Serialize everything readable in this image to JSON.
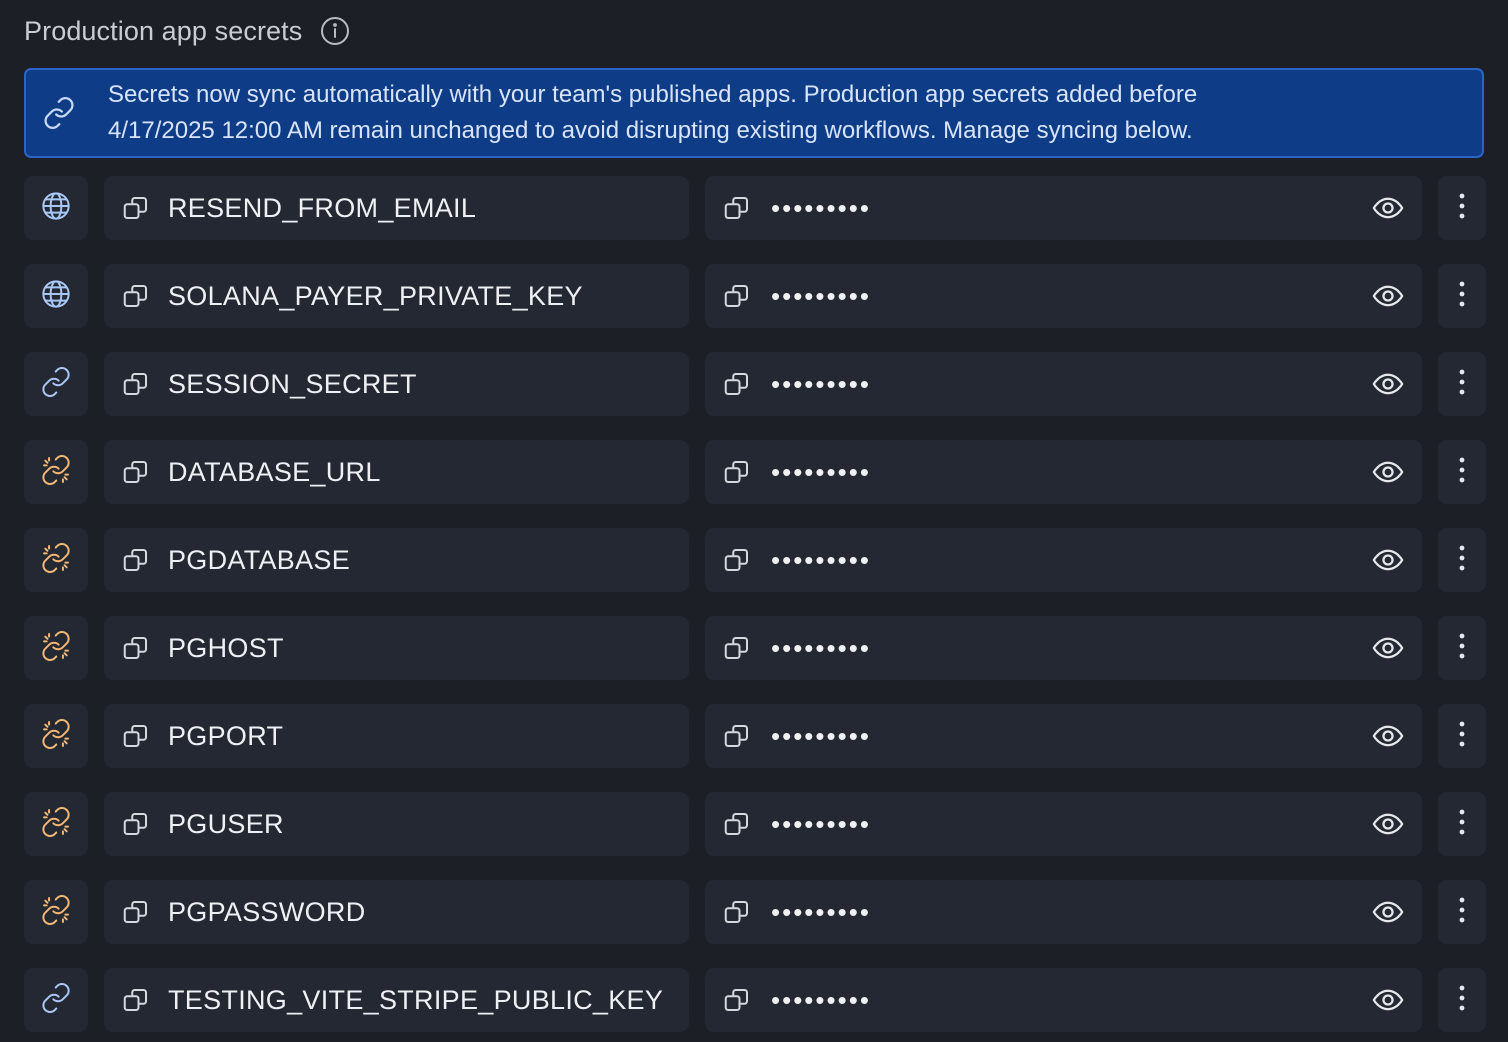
{
  "header": {
    "title": "Production app secrets",
    "info_icon": "info-icon"
  },
  "banner": {
    "icon": "link-icon",
    "line1": "Secrets now sync automatically with your team's published apps. Production app secrets added before",
    "line2": "4/17/2025 12:00 AM remain unchanged to avoid disrupting existing workflows. Manage syncing below."
  },
  "colors": {
    "background": "#1c1f26",
    "cell": "#242832",
    "banner_bg": "#0f3c87",
    "banner_border": "#2c63c7",
    "synced_icon": "#a9c7f5",
    "unsynced_icon": "#f2b672"
  },
  "secrets": [
    {
      "key": "RESEND_FROM_EMAIL",
      "value_masked": "•••••••••",
      "sync_icon": "globe-icon"
    },
    {
      "key": "SOLANA_PAYER_PRIVATE_KEY",
      "value_masked": "•••••••••",
      "sync_icon": "globe-icon"
    },
    {
      "key": "SESSION_SECRET",
      "value_masked": "•••••••••",
      "sync_icon": "link-icon"
    },
    {
      "key": "DATABASE_URL",
      "value_masked": "•••••••••",
      "sync_icon": "unlink-icon"
    },
    {
      "key": "PGDATABASE",
      "value_masked": "•••••••••",
      "sync_icon": "unlink-icon"
    },
    {
      "key": "PGHOST",
      "value_masked": "•••••••••",
      "sync_icon": "unlink-icon"
    },
    {
      "key": "PGPORT",
      "value_masked": "•••••••••",
      "sync_icon": "unlink-icon"
    },
    {
      "key": "PGUSER",
      "value_masked": "•••••••••",
      "sync_icon": "unlink-icon"
    },
    {
      "key": "PGPASSWORD",
      "value_masked": "•••••••••",
      "sync_icon": "unlink-icon"
    },
    {
      "key": "TESTING_VITE_STRIPE_PUBLIC_KEY",
      "value_masked": "•••••••••",
      "sync_icon": "link-icon"
    }
  ]
}
